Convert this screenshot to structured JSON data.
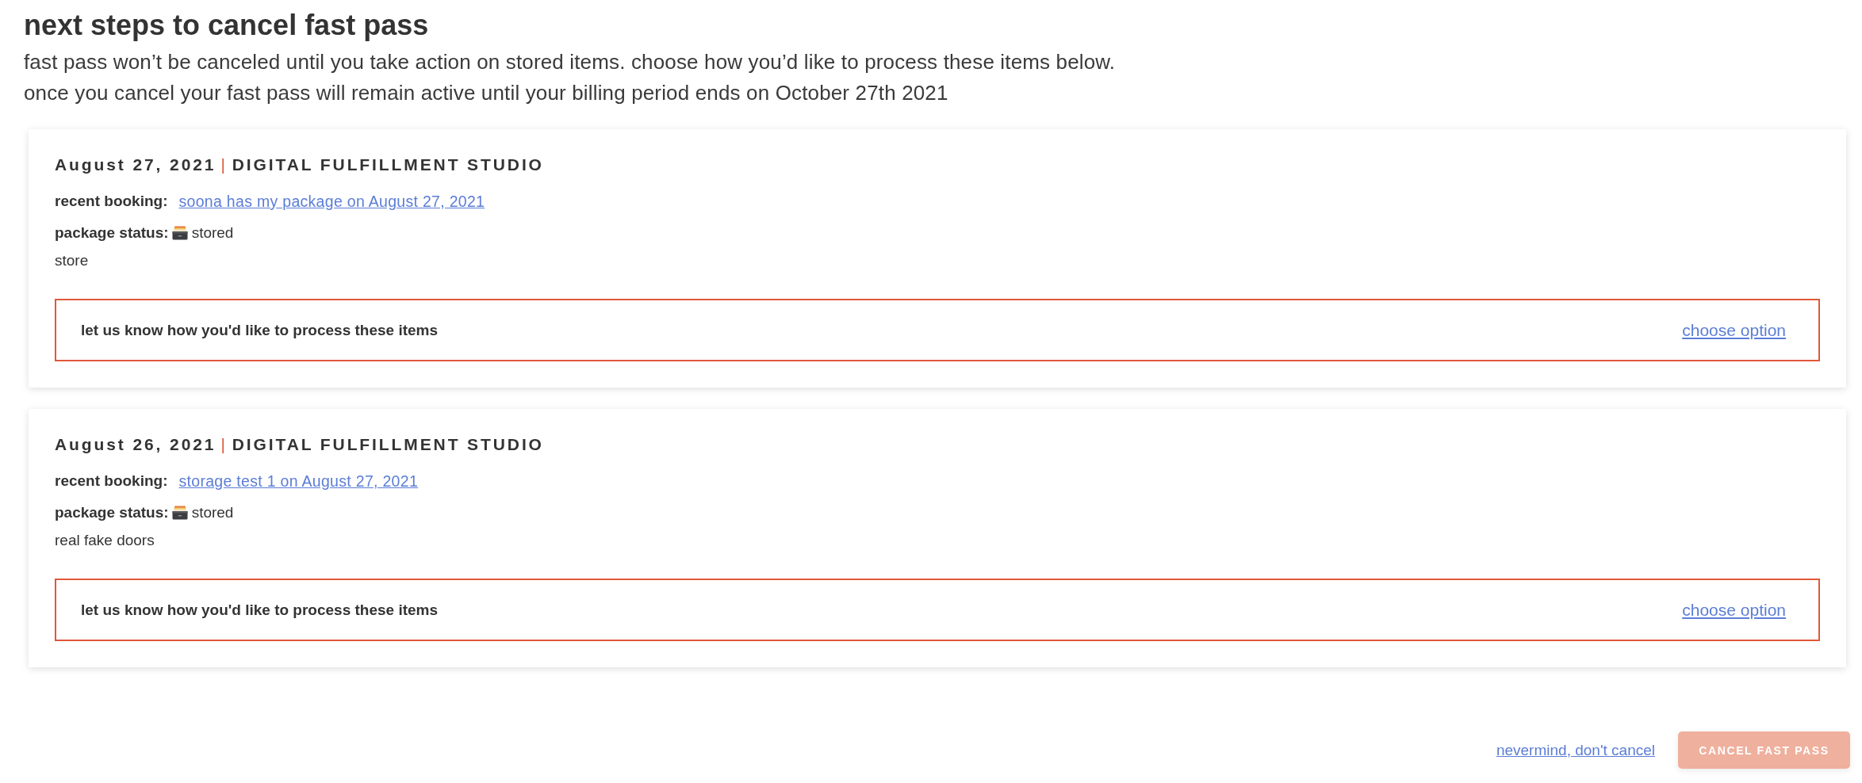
{
  "header": {
    "title": "next steps to cancel fast pass",
    "description": [
      "fast pass won’t be canceled until you take action on stored items. choose how you’d like to process these items below.",
      "once you cancel your fast pass will remain active until your billing period ends on October 27th 2021"
    ]
  },
  "cards": [
    {
      "date": "August 27, 2021",
      "separator": "|",
      "studio": "DIGITAL FULFILLMENT STUDIO",
      "booking_label": "recent booking:",
      "booking_link": "soona has my package on August 27, 2021",
      "status_label": "package status:",
      "status": "stored",
      "note": "store",
      "prompt": {
        "text": "let us know how you'd like to process these items",
        "action": "choose option"
      }
    },
    {
      "date": "August 26, 2021",
      "separator": "|",
      "studio": "DIGITAL FULFILLMENT STUDIO",
      "booking_label": "recent booking:",
      "booking_link": "storage test 1 on August 27, 2021",
      "status_label": "package status:",
      "status": "stored",
      "note": "real fake doors",
      "prompt": {
        "text": "let us know how you'd like to process these items",
        "action": "choose option"
      }
    }
  ],
  "footer": {
    "cancel_link": "nevermind, don't cancel",
    "confirm_button": {
      "label": "CANCEL FAST PASS",
      "disabled": true
    }
  }
}
